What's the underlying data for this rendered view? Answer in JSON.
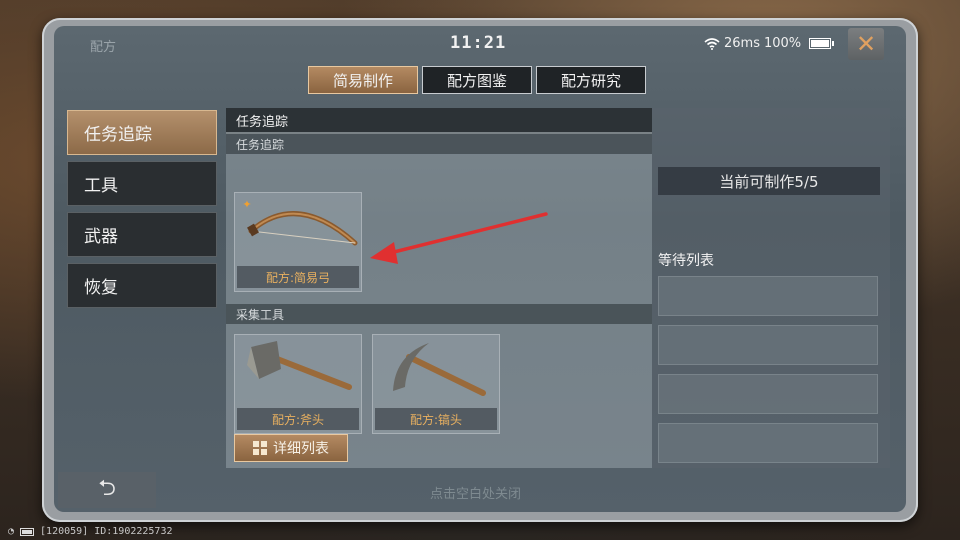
{
  "window": {
    "title": "配方",
    "time": "11:21",
    "network": "26ms",
    "battery": "100%"
  },
  "tabs": [
    {
      "label": "简易制作",
      "active": true
    },
    {
      "label": "配方图鉴",
      "active": false
    },
    {
      "label": "配方研究",
      "active": false
    }
  ],
  "sidebar": {
    "items": [
      {
        "label": "任务追踪",
        "active": true
      },
      {
        "label": "工具",
        "active": false
      },
      {
        "label": "武器",
        "active": false
      },
      {
        "label": "恢复",
        "active": false
      }
    ]
  },
  "main": {
    "header": "任务追踪",
    "sections": [
      {
        "title": "任务追踪",
        "items": [
          {
            "label": "配方:简易弓",
            "icon": "bow-icon"
          }
        ]
      },
      {
        "title": "采集工具",
        "items": [
          {
            "label": "配方:斧头",
            "icon": "axe-icon"
          },
          {
            "label": "配方:镐头",
            "icon": "pickaxe-icon"
          }
        ]
      }
    ],
    "detail_button": "详细列表"
  },
  "right_panel": {
    "can_make": "当前可制作5/5",
    "wait_title": "等待列表",
    "slots": 4
  },
  "footer": {
    "hint": "点击空白处关闭",
    "device_info": "[120059] ID:1902225732"
  },
  "colors": {
    "accent": "#b48a62",
    "annotation_arrow": "#e03030",
    "item_label": "#e8b060"
  }
}
